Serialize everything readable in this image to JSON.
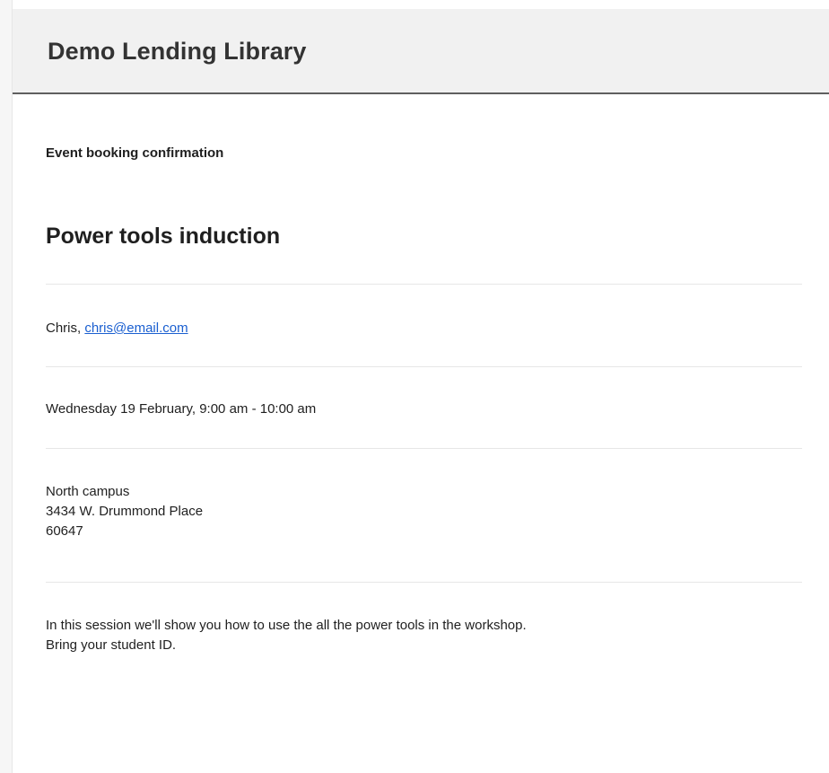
{
  "header": {
    "title": "Demo Lending Library"
  },
  "booking": {
    "kicker": "Event booking confirmation",
    "event_title": "Power tools induction",
    "attendee_name": "Chris,",
    "attendee_email": "chris@email.com",
    "datetime": "Wednesday 19 February, 9:00 am - 10:00 am",
    "location": {
      "line1": "North campus",
      "line2": "3434 W. Drummond Place",
      "line3": "60647"
    },
    "notes": {
      "line1": "In this session we'll show you how to use the all the power tools in the workshop.",
      "line2": "Bring your student ID."
    }
  },
  "colors": {
    "link": "#1a5fd0",
    "header_bg": "#f1f1f1",
    "header_border": "#5f5f5f",
    "divider": "#e7e7e7"
  }
}
